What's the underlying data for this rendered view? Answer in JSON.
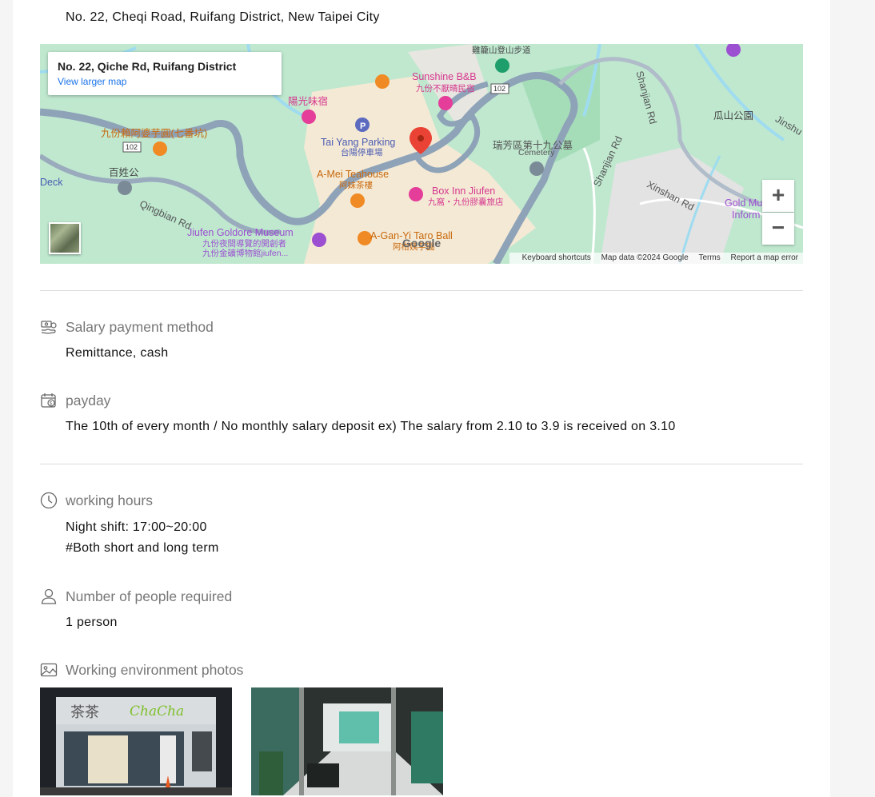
{
  "address": "No. 22, Cheqi Road, Ruifang District, New Taipei City",
  "map": {
    "info_title": "No. 22, Qiche Rd, Ruifang District",
    "info_link": "View larger map",
    "zoom_in": "+",
    "zoom_out": "−",
    "footer": {
      "shortcuts": "Keyboard shortcuts",
      "data": "Map data ©2024 Google",
      "terms": "Terms",
      "report": "Report a map error"
    },
    "google": "Google",
    "labels": {
      "sunshine": "Sunshine B&B",
      "sunshine_zh": "九份不厭晴民宿",
      "yangguang": "陽光味宿",
      "taro": "九份賴阿婆芋圓(七番坑)",
      "taiyang": "Tai Yang Parking",
      "taiyang_zh": "台陽停車場",
      "amei": "A-Mei Teahouse",
      "amei_zh": "阿妹茶樓",
      "boxinn": "Box Inn Jiufen",
      "boxinn_zh": "九窩・九份膠囊旅店",
      "cemetery_zh": "瑞芳區第十九公墓",
      "cemetery": "Cemetery",
      "baixing": "百姓公",
      "qingbian": "Qingbian Rd",
      "goldore": "Jiufen Goldore Museum",
      "goldore_zh1": "九份夜間導覽的開創者",
      "goldore_zh2": "九份金礦博物館jiufen...",
      "aganyi": "A-Gan-Yi Taro Ball",
      "aganyi_zh": "阿柑姨芋圓",
      "shanjian1": "Shanjian Rd",
      "shanjian2": "Shanjian Rd",
      "xinshan": "Xinshan Rd",
      "guashan": "瓜山公園",
      "jinshu": "Jinshu",
      "goldmu": "Gold Mu",
      "inform": "Inform",
      "trail": "雞籠山登山步道",
      "deck": "Deck",
      "r102a": "102",
      "r102b": "102",
      "parking": "P"
    }
  },
  "sections": {
    "salary_method": {
      "title": "Salary payment method",
      "value": "Remittance, cash"
    },
    "payday": {
      "title": "payday",
      "value": "The 10th of every month / No monthly salary deposit ex) The salary from 2.10 to 3.9 is received on 3.10"
    },
    "working_hours": {
      "title": "working hours",
      "line1": "Night shift: 17:00~20:00",
      "line2": "#Both short and long term"
    },
    "people": {
      "title": "Number of people required",
      "value": "1 person"
    },
    "photos": {
      "title": "Working environment photos",
      "sign_zh": "茶茶",
      "sign_en": "ChaCha"
    }
  },
  "icons": {
    "salary": "money-hand-icon",
    "payday": "calendar-money-icon",
    "hours": "clock-icon",
    "people": "person-icon",
    "photos": "image-icon"
  }
}
